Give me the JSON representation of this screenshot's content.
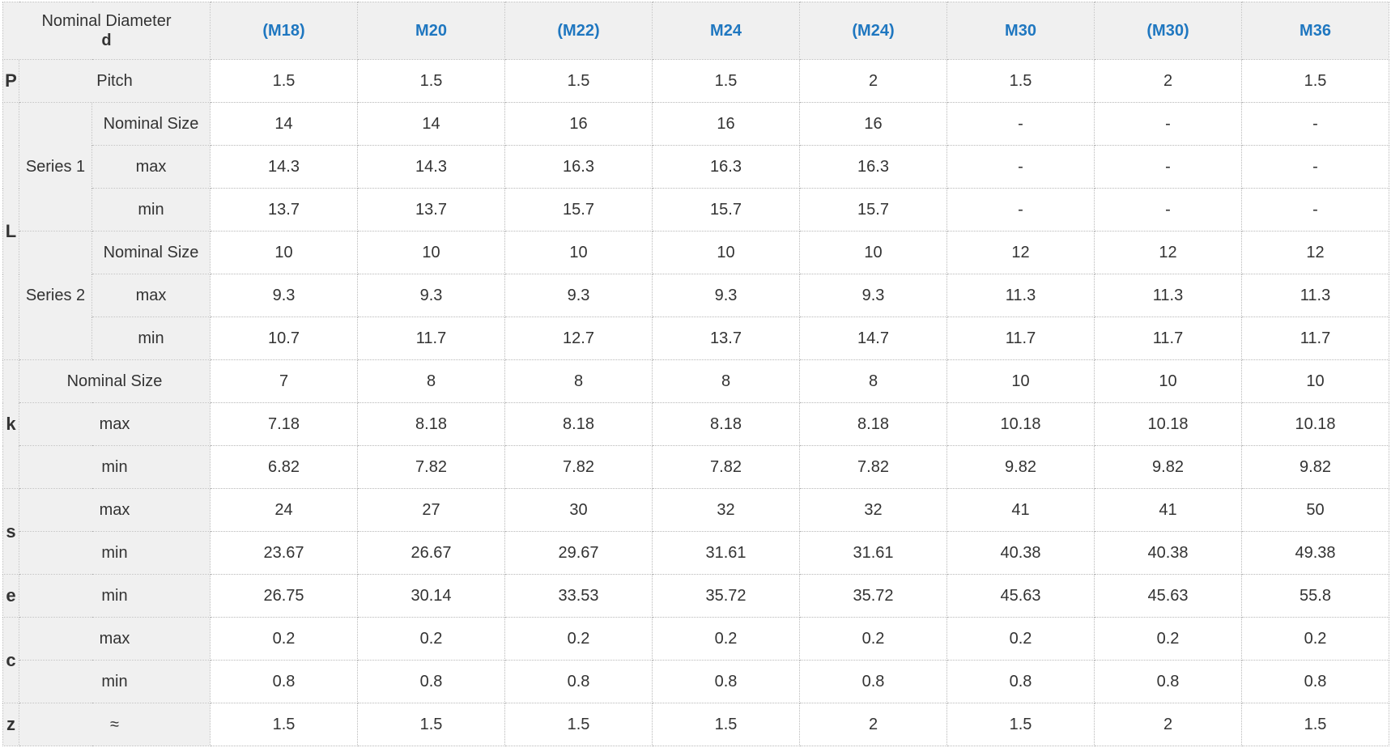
{
  "header": {
    "title_line1": "Nominal Diameter",
    "title_line2": "d",
    "sizes": [
      "(M18)",
      "M20",
      "(M22)",
      "M24",
      "(M24)",
      "M30",
      "(M30)",
      "M36"
    ]
  },
  "pitch": {
    "symbol": "P",
    "label": "Pitch",
    "values": [
      "1.5",
      "1.5",
      "1.5",
      "1.5",
      "2",
      "1.5",
      "2",
      "1.5"
    ]
  },
  "length": {
    "symbol": "L",
    "series1": {
      "label": "Series 1",
      "nominal": {
        "label": "Nominal Size",
        "values": [
          "14",
          "14",
          "16",
          "16",
          "16",
          "-",
          "-",
          "-"
        ]
      },
      "max": {
        "label": "max",
        "values": [
          "14.3",
          "14.3",
          "16.3",
          "16.3",
          "16.3",
          "-",
          "-",
          "-"
        ]
      },
      "min": {
        "label": "min",
        "values": [
          "13.7",
          "13.7",
          "15.7",
          "15.7",
          "15.7",
          "-",
          "-",
          "-"
        ]
      }
    },
    "series2": {
      "label": "Series 2",
      "nominal": {
        "label": "Nominal Size",
        "values": [
          "10",
          "10",
          "10",
          "10",
          "10",
          "12",
          "12",
          "12"
        ]
      },
      "max": {
        "label": "max",
        "values": [
          "9.3",
          "9.3",
          "9.3",
          "9.3",
          "9.3",
          "11.3",
          "11.3",
          "11.3"
        ]
      },
      "min": {
        "label": "min",
        "values": [
          "10.7",
          "11.7",
          "12.7",
          "13.7",
          "14.7",
          "11.7",
          "11.7",
          "11.7"
        ]
      }
    }
  },
  "k": {
    "symbol": "k",
    "nominal": {
      "label": "Nominal Size",
      "values": [
        "7",
        "8",
        "8",
        "8",
        "8",
        "10",
        "10",
        "10"
      ]
    },
    "max": {
      "label": "max",
      "values": [
        "7.18",
        "8.18",
        "8.18",
        "8.18",
        "8.18",
        "10.18",
        "10.18",
        "10.18"
      ]
    },
    "min": {
      "label": "min",
      "values": [
        "6.82",
        "7.82",
        "7.82",
        "7.82",
        "7.82",
        "9.82",
        "9.82",
        "9.82"
      ]
    }
  },
  "s": {
    "symbol": "s",
    "max": {
      "label": "max",
      "values": [
        "24",
        "27",
        "30",
        "32",
        "32",
        "41",
        "41",
        "50"
      ]
    },
    "min": {
      "label": "min",
      "values": [
        "23.67",
        "26.67",
        "29.67",
        "31.61",
        "31.61",
        "40.38",
        "40.38",
        "49.38"
      ]
    }
  },
  "e": {
    "symbol": "e",
    "min": {
      "label": "min",
      "values": [
        "26.75",
        "30.14",
        "33.53",
        "35.72",
        "35.72",
        "45.63",
        "45.63",
        "55.8"
      ]
    }
  },
  "c": {
    "symbol": "c",
    "max": {
      "label": "max",
      "values": [
        "0.2",
        "0.2",
        "0.2",
        "0.2",
        "0.2",
        "0.2",
        "0.2",
        "0.2"
      ]
    },
    "min": {
      "label": "min",
      "values": [
        "0.8",
        "0.8",
        "0.8",
        "0.8",
        "0.8",
        "0.8",
        "0.8",
        "0.8"
      ]
    }
  },
  "z": {
    "symbol": "z",
    "approx": {
      "label": "≈",
      "values": [
        "1.5",
        "1.5",
        "1.5",
        "1.5",
        "2",
        "1.5",
        "2",
        "1.5"
      ]
    }
  },
  "colors": {
    "header_bg": "#f0f0f0",
    "size_text": "#1f77c0",
    "border": "#b8b8b8",
    "text": "#333333"
  }
}
